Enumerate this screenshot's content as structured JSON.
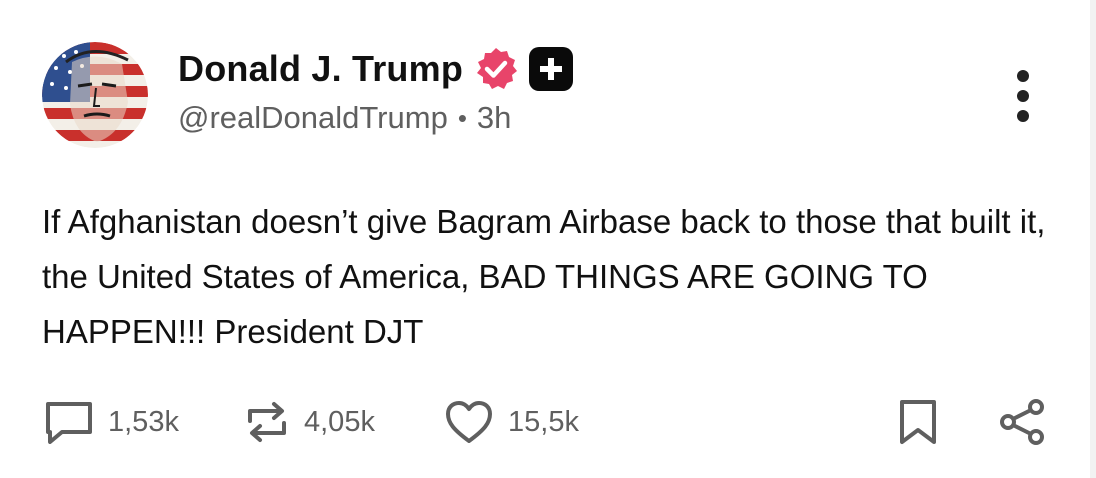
{
  "author": {
    "display_name": "Donald J. Trump",
    "handle": "@realDonaldTrump",
    "separator": "•",
    "time_ago": "3h",
    "verified_icon": "verified-badge-icon",
    "plus_icon": "plus-badge-icon"
  },
  "post": {
    "text": "If Afghanistan doesn’t give Bagram Airbase back to those that built it, the United States of America, BAD THINGS ARE GOING TO HAPPEN!!! President DJT"
  },
  "actions": {
    "replies": "1,53k",
    "reposts": "4,05k",
    "likes": "15,5k"
  },
  "colors": {
    "verified": "#e8446a",
    "text": "#111111",
    "muted": "#5f5f5f",
    "plus_badge": "#0a0a0a"
  }
}
